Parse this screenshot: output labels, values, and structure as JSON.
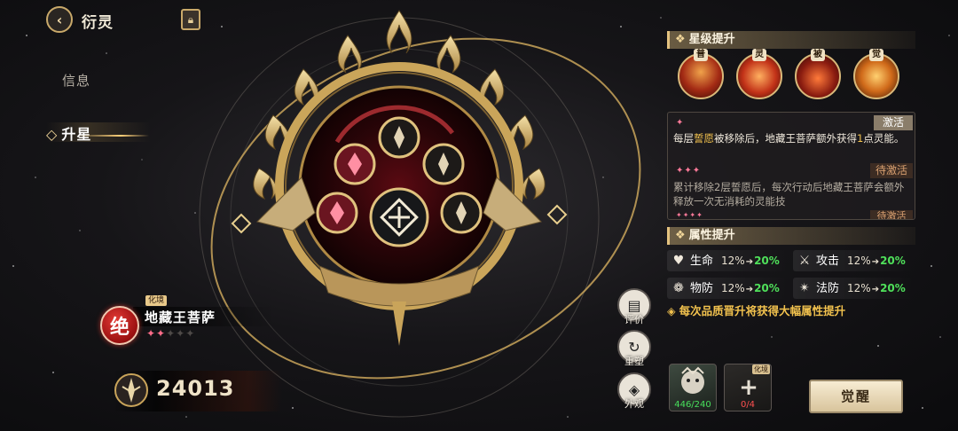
{
  "nav": {
    "back_icon": "chevron-left-icon",
    "title": "衍灵",
    "lock_icon": "lock-icon",
    "tabs": [
      {
        "label": "信息"
      },
      {
        "label": "升星"
      }
    ]
  },
  "character": {
    "grade": "绝",
    "tag": "化境",
    "name": "地藏王菩萨",
    "stars_on": "✦✦",
    "stars_off": "✦✦✦",
    "power": "24013"
  },
  "actions": [
    {
      "label": "评价",
      "icon": "scroll-icon"
    },
    {
      "label": "重塑",
      "icon": "swirl-icon"
    },
    {
      "label": "外观",
      "icon": "costume-icon"
    }
  ],
  "star_upgrade": {
    "title": "星级提升",
    "icons": [
      {
        "tag": "普",
        "icon": "fire-spirit-icon"
      },
      {
        "tag": "灵",
        "icon": "lotus-flame-icon"
      },
      {
        "tag": "被",
        "icon": "passive-flame-icon"
      },
      {
        "tag": "觉",
        "icon": "awaken-orb-icon"
      }
    ],
    "tiers": [
      {
        "stars": "✦",
        "status": "激活",
        "text_a": "每层",
        "text_hl": "誓愿",
        "text_b": "被移除后，地藏王菩萨额外获得",
        "text_num": "1",
        "text_c": "点灵能。"
      },
      {
        "stars": "✦✦✦",
        "status": "待激活",
        "text": "累计移除2层誓愿后，每次行动后地藏王菩萨会额外释放一次无消耗的灵能技"
      },
      {
        "stars": "✦✦✦✦",
        "status": "待激活"
      }
    ]
  },
  "attributes": {
    "title": "属性提升",
    "items": [
      {
        "name": "生命",
        "base": "12%",
        "up": "20%",
        "icon": "heart-shield-icon"
      },
      {
        "name": "攻击",
        "base": "12%",
        "up": "20%",
        "icon": "sword-icon"
      },
      {
        "name": "物防",
        "base": "12%",
        "up": "20%",
        "icon": "lotus-shield-icon"
      },
      {
        "name": "法防",
        "base": "12%",
        "up": "20%",
        "icon": "magic-shield-icon"
      }
    ],
    "note": "每次品质晋升将获得大幅属性提升"
  },
  "materials": [
    {
      "count": "446/240",
      "icon": "soul-shard-icon"
    },
    {
      "count": "0/4",
      "tag": "化境",
      "icon": "add-icon"
    }
  ],
  "awaken_button": "觉醒",
  "colors": {
    "accent_gold": "#e4c27f",
    "gain_green": "#4fe05a",
    "lack_red": "#ff5050",
    "highlight_yellow": "#f2c24e",
    "star_pink": "#ff7a9a"
  }
}
